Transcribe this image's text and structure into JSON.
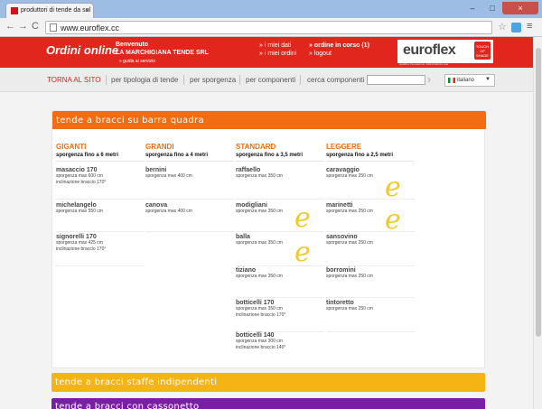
{
  "browser": {
    "tab_title": "produttori di tende da sol",
    "tab_close": "×",
    "url": "www.euroflex.cc",
    "nav_back": "←",
    "nav_forward": "→",
    "nav_reload": "C",
    "star": "☆",
    "menu": "≡",
    "win_min": "–",
    "win_max": "□",
    "win_close": "×"
  },
  "header": {
    "title": "Ordini online",
    "welcome_label": "Benvenuto",
    "company": "LA MARCHIGIANA TENDE SRL",
    "guide": "» guida ai servizio",
    "my_data": "» i miei dati",
    "my_orders": "» i miei ordini",
    "orders_in_progress": "» ordine in corso (1)",
    "logout": "» logout",
    "logo": "euroflex",
    "logo_badge": "TOUCH OF SHADE",
    "logo_tagline": "qualità e innovazione nella tenda da sole"
  },
  "subnav": {
    "home": "TORNA AL SITO",
    "by_type": "per tipologia di tende",
    "by_projection": "per sporgenza",
    "by_components": "per componenti",
    "search_label": "cerca componenti",
    "search_value": "",
    "language": "italiano",
    "caret": "▼",
    "arrow": "›"
  },
  "section": {
    "title": "tende a bracci su barra quadra",
    "columns": [
      {
        "title": "GIGANTI",
        "subtitle": "sporgenza fino a 6 metri",
        "products": [
          {
            "name": "masaccio 170",
            "lines": [
              "sporgenza max 600 cm",
              "inclinazione braccio 170°"
            ]
          },
          {
            "name": "michelangelo",
            "lines": [
              "sporgenza max 550 cm"
            ]
          },
          {
            "name": "signorelli 170",
            "lines": [
              "sporgenza max 425 cm",
              "inclinazione braccio 170°"
            ]
          }
        ]
      },
      {
        "title": "GRANDI",
        "subtitle": "sporgenza fino a 4 metri",
        "products": [
          {
            "name": "bernini",
            "lines": [
              "sporgenza max 400 cm"
            ]
          },
          {
            "name": "canova",
            "lines": [
              "sporgenza max 400 cm"
            ]
          }
        ]
      },
      {
        "title": "STANDARD",
        "subtitle": "sporgenza fino a 3,5 metri",
        "products": [
          {
            "name": "raffaello",
            "lines": [
              "sporgenza max 350 cm"
            ]
          },
          {
            "name": "modigliani",
            "lines": [
              "sporgenza max 350 cm"
            ]
          },
          {
            "name": "balla",
            "lines": [
              "sporgenza max 350 cm"
            ]
          },
          {
            "name": "tiziano",
            "lines": [
              "sporgenza max 350 cm"
            ]
          },
          {
            "name": "botticelli 170",
            "lines": [
              "sporgenza max 350 cm",
              "inclinazione braccio 170°"
            ]
          },
          {
            "name": "botticelli 140",
            "lines": [
              "sporgenza max 300 cm",
              "inclinazione braccio 140°"
            ]
          }
        ]
      },
      {
        "title": "LEGGERE",
        "subtitle": "sporgenza fino a 2,5 metri",
        "products": [
          {
            "name": "caravaggio",
            "lines": [
              "sporgenza max 250 cm"
            ]
          },
          {
            "name": "marinetti",
            "lines": [
              "sporgenza max 250 cm"
            ]
          },
          {
            "name": "sansovino",
            "lines": [
              "sporgenza max 250 cm"
            ]
          },
          {
            "name": "borromini",
            "lines": [
              "sporgenza max 250 cm"
            ]
          },
          {
            "name": "tintoretto",
            "lines": [
              "sporgenza max 250 cm"
            ]
          }
        ]
      }
    ],
    "e_mark": "e"
  },
  "section2": {
    "title": "tende a bracci staffe indipendenti"
  },
  "section3": {
    "title": "tende a bracci con cassonetto"
  },
  "colors": {
    "brand_red": "#e1261d",
    "orange": "#f16c13",
    "yellow": "#f5b414",
    "purple": "#7a1ea8",
    "e_mark": "#f4c82a"
  }
}
